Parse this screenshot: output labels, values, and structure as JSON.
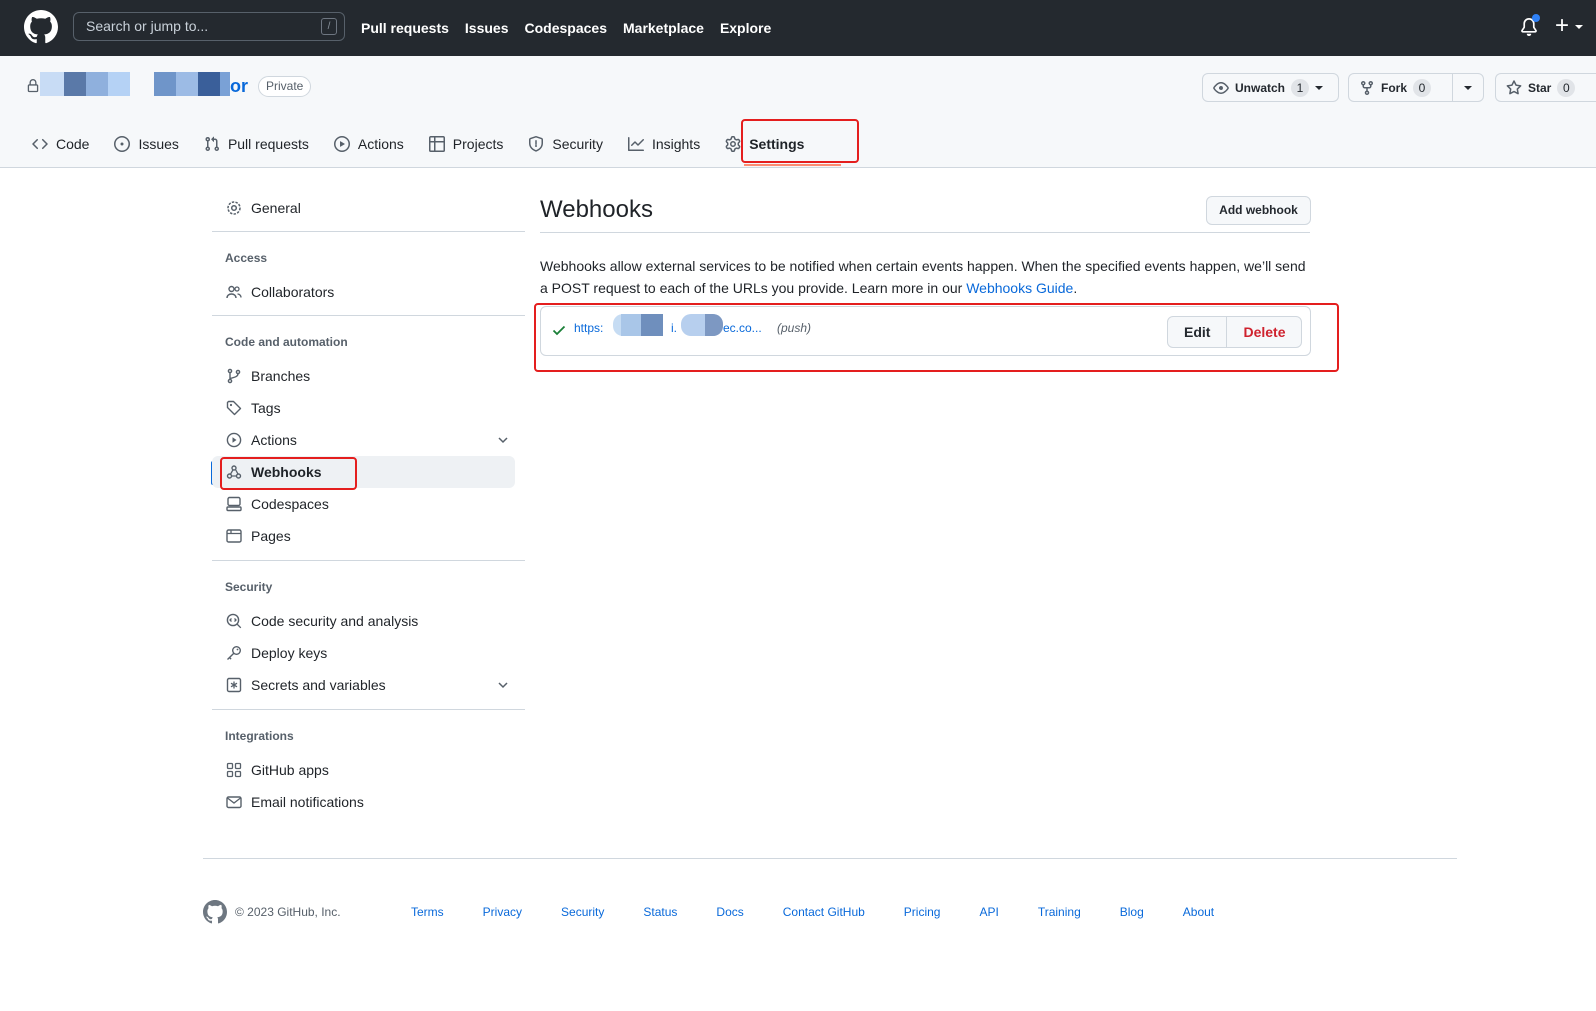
{
  "topbar": {
    "search_placeholder": "Search or jump to...",
    "search_shortcut": "/",
    "nav": [
      "Pull requests",
      "Issues",
      "Codespaces",
      "Marketplace",
      "Explore"
    ]
  },
  "repo": {
    "name_visible_suffix": "or",
    "visibility": "Private",
    "watch": {
      "label": "Unwatch",
      "count": "1"
    },
    "fork": {
      "label": "Fork",
      "count": "0"
    },
    "star": {
      "label": "Star",
      "count": "0"
    }
  },
  "repo_nav": {
    "tabs": [
      "Code",
      "Issues",
      "Pull requests",
      "Actions",
      "Projects",
      "Security",
      "Insights",
      "Settings"
    ],
    "selected": "Settings"
  },
  "sidebar": {
    "general": "General",
    "access_heading": "Access",
    "collaborators": "Collaborators",
    "code_heading": "Code and automation",
    "branches": "Branches",
    "tags": "Tags",
    "actions": "Actions",
    "webhooks": "Webhooks",
    "codespaces": "Codespaces",
    "pages": "Pages",
    "security_heading": "Security",
    "code_security": "Code security and analysis",
    "deploy_keys": "Deploy keys",
    "secrets": "Secrets and variables",
    "integrations_heading": "Integrations",
    "github_apps": "GitHub apps",
    "email_notifications": "Email notifications"
  },
  "main": {
    "title": "Webhooks",
    "add_button": "Add webhook",
    "description": "Webhooks allow external services to be notified when certain events happen. When the specified events happen, we’ll send a POST request to each of the URLs you provide. Learn more in our ",
    "guide_link": "Webhooks Guide",
    "description_end": ".",
    "hook": {
      "url_prefix": "https:",
      "url_mid": "i.",
      "url_suffix": "ec.co...",
      "events": "(push)",
      "edit": "Edit",
      "delete": "Delete"
    }
  },
  "footer": {
    "copyright": "© 2023 GitHub, Inc.",
    "links": [
      "Terms",
      "Privacy",
      "Security",
      "Status",
      "Docs",
      "Contact GitHub",
      "Pricing",
      "API",
      "Training",
      "Blog",
      "About"
    ]
  },
  "colors": {
    "header_bg": "#24292f",
    "link": "#0969da",
    "danger": "#cf222e",
    "highlight_box": "#e41e1e",
    "success": "#1a7f37"
  }
}
